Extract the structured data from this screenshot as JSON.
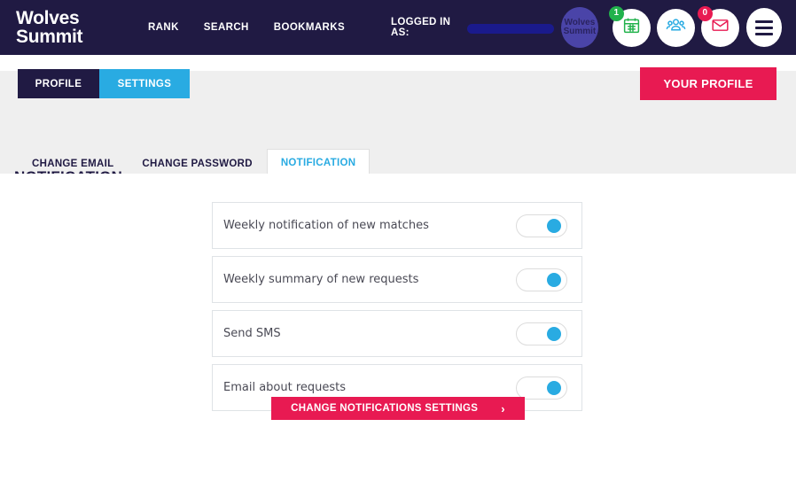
{
  "header": {
    "logo_line1": "Wolves",
    "logo_line2": "Summit",
    "logo_text": "Wolves\nSummit",
    "nav": [
      {
        "label": "RANK",
        "name": "nav-rank"
      },
      {
        "label": "SEARCH",
        "name": "nav-search"
      },
      {
        "label": "BOOKMARKS",
        "name": "nav-bookmarks"
      }
    ],
    "logged_in_label": "LOGGED IN AS:",
    "logged_in_value": "",
    "avatar_text": "Wolves\nSummit",
    "icons": {
      "calendar": {
        "name": "calendar-icon",
        "badge": "1",
        "badge_color": "#22b24c"
      },
      "people": {
        "name": "people-icon",
        "badge": null
      },
      "mail": {
        "name": "envelope-icon",
        "badge": "0",
        "badge_color": "#E81A52"
      },
      "menu": {
        "name": "hamburger-menu-icon"
      }
    }
  },
  "tabs_top": [
    {
      "label": "PROFILE",
      "active": false
    },
    {
      "label": "SETTINGS",
      "active": true
    }
  ],
  "profile_button": "YOUR PROFILE",
  "page_title": "NOTIFICATION",
  "subtabs": [
    {
      "label": "CHANGE EMAIL",
      "active": false
    },
    {
      "label": "CHANGE PASSWORD",
      "active": false
    },
    {
      "label": "NOTIFICATION",
      "active": true
    }
  ],
  "notification_rows": [
    {
      "label": "Weekly notification of new matches",
      "enabled": true
    },
    {
      "label": "Weekly summary of new requests",
      "enabled": true
    },
    {
      "label": "Send SMS",
      "enabled": true
    },
    {
      "label": "Email about requests",
      "enabled": true
    }
  ],
  "submit_button": {
    "label": "CHANGE NOTIFICATIONS SETTINGS",
    "chevron": "›"
  },
  "colors": {
    "navy": "#201A43",
    "cyan": "#29ABE2",
    "crimson": "#E81A52",
    "green": "#22b24c",
    "band_grey": "#efefef"
  }
}
